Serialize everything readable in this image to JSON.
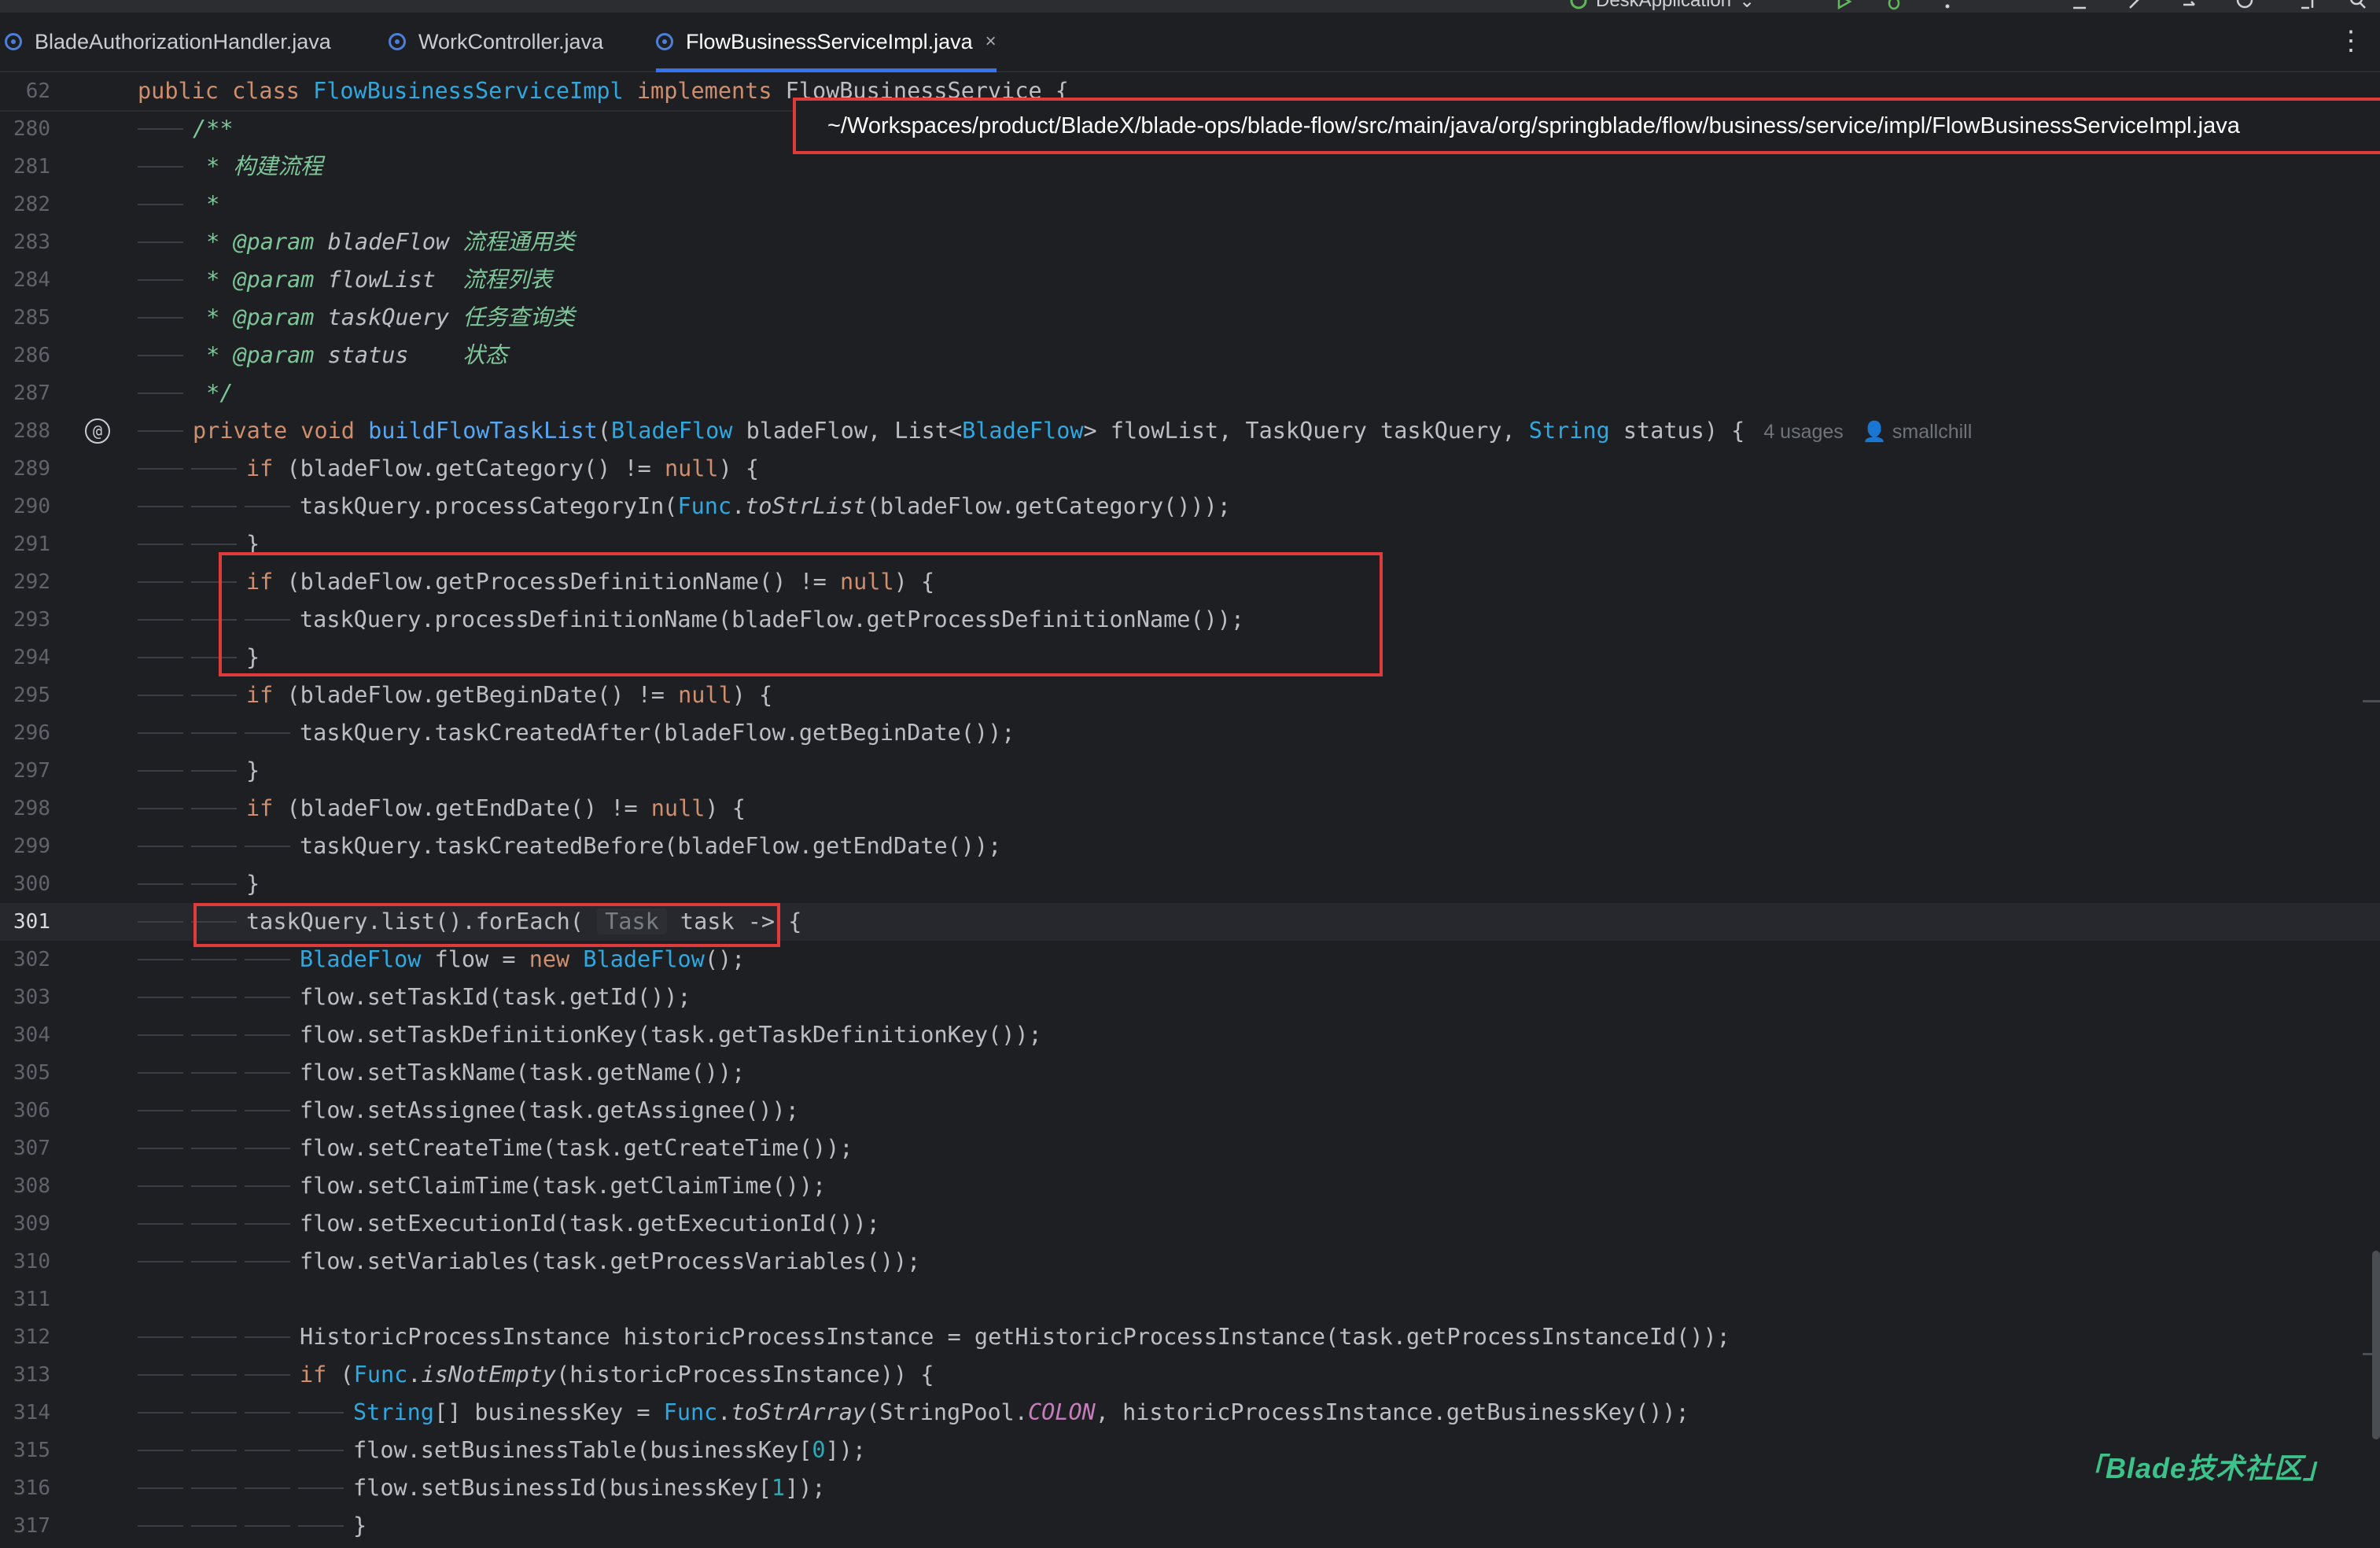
{
  "toolbar": {
    "run_config": "DeskApplication"
  },
  "tabs": [
    {
      "label": "BladeAuthorizationHandler.java",
      "active": false
    },
    {
      "label": "WorkController.java",
      "active": false
    },
    {
      "label": "FlowBusinessServiceImpl.java",
      "active": true
    }
  ],
  "tab_close_glyph": "×",
  "tooltip": {
    "path": "~/Workspaces/product/BladeX/blade-ops/blade-flow/src/main/java/org/springblade/flow/business/service/impl/FlowBusinessServiceImpl.java"
  },
  "sticky": {
    "line_no": "62",
    "code": "public class FlowBusinessServiceImpl implements FlowBusinessService {"
  },
  "inlay": {
    "usages": "4 usages",
    "author": "smallchill",
    "param_hint": "Task"
  },
  "gutter": {
    "at_symbol": "@"
  },
  "lines": [
    {
      "n": "280",
      "t": "/**"
    },
    {
      "n": "281",
      "t": " * 构建流程"
    },
    {
      "n": "282",
      "t": " *"
    },
    {
      "n": "283",
      "t": " * @param bladeFlow 流程通用类"
    },
    {
      "n": "284",
      "t": " * @param flowList  流程列表"
    },
    {
      "n": "285",
      "t": " * @param taskQuery 任务查询类"
    },
    {
      "n": "286",
      "t": " * @param status    状态"
    },
    {
      "n": "287",
      "t": " */"
    },
    {
      "n": "288",
      "t": "private void buildFlowTaskList(BladeFlow bladeFlow, List<BladeFlow> flowList, TaskQuery taskQuery, String status) {"
    },
    {
      "n": "289",
      "t": "if (bladeFlow.getCategory() != null) {"
    },
    {
      "n": "290",
      "t": "taskQuery.processCategoryIn(Func.toStrList(bladeFlow.getCategory()));"
    },
    {
      "n": "291",
      "t": "}"
    },
    {
      "n": "292",
      "t": "if (bladeFlow.getProcessDefinitionName() != null) {"
    },
    {
      "n": "293",
      "t": "taskQuery.processDefinitionName(bladeFlow.getProcessDefinitionName());"
    },
    {
      "n": "294",
      "t": "}"
    },
    {
      "n": "295",
      "t": "if (bladeFlow.getBeginDate() != null) {"
    },
    {
      "n": "296",
      "t": "taskQuery.taskCreatedAfter(bladeFlow.getBeginDate());"
    },
    {
      "n": "297",
      "t": "}"
    },
    {
      "n": "298",
      "t": "if (bladeFlow.getEndDate() != null) {"
    },
    {
      "n": "299",
      "t": "taskQuery.taskCreatedBefore(bladeFlow.getEndDate());"
    },
    {
      "n": "300",
      "t": "}"
    },
    {
      "n": "301",
      "t": "taskQuery.list().forEach( task -> {"
    },
    {
      "n": "302",
      "t": "BladeFlow flow = new BladeFlow();"
    },
    {
      "n": "303",
      "t": "flow.setTaskId(task.getId());"
    },
    {
      "n": "304",
      "t": "flow.setTaskDefinitionKey(task.getTaskDefinitionKey());"
    },
    {
      "n": "305",
      "t": "flow.setTaskName(task.getName());"
    },
    {
      "n": "306",
      "t": "flow.setAssignee(task.getAssignee());"
    },
    {
      "n": "307",
      "t": "flow.setCreateTime(task.getCreateTime());"
    },
    {
      "n": "308",
      "t": "flow.setClaimTime(task.getClaimTime());"
    },
    {
      "n": "309",
      "t": "flow.setExecutionId(task.getExecutionId());"
    },
    {
      "n": "310",
      "t": "flow.setVariables(task.getProcessVariables());"
    },
    {
      "n": "311",
      "t": ""
    },
    {
      "n": "312",
      "t": "HistoricProcessInstance historicProcessInstance = getHistoricProcessInstance(task.getProcessInstanceId());"
    },
    {
      "n": "313",
      "t": "if (Func.isNotEmpty(historicProcessInstance)) {"
    },
    {
      "n": "314",
      "t": "String[] businessKey = Func.toStrArray(StringPool.COLON, historicProcessInstance.getBusinessKey());"
    },
    {
      "n": "315",
      "t": "flow.setBusinessTable(businessKey[0]);"
    },
    {
      "n": "316",
      "t": "flow.setBusinessId(businessKey[1]);"
    },
    {
      "n": "317",
      "t": "}"
    }
  ],
  "watermark": "Blade技术社区",
  "colors": {
    "highlight_box": "#e03b3b",
    "keyword": "#cf8e6d",
    "type": "#2fa8e0",
    "method": "#56a8f5",
    "comment": "#7ec699"
  }
}
